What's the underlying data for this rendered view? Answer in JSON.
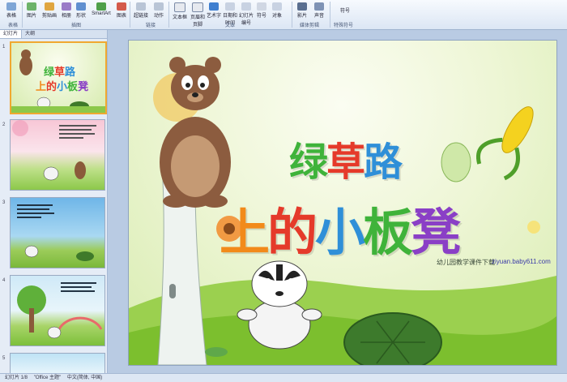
{
  "ribbon": {
    "buttons": [
      "表格",
      "图片",
      "剪贴画",
      "相册",
      "形状",
      "SmartArt",
      "图表",
      "超链接",
      "动作",
      "文本框",
      "页眉和页脚",
      "艺术字",
      "日期和时间",
      "幻灯片编号",
      "符号",
      "对象",
      "影片",
      "声音"
    ],
    "groups": [
      "表格",
      "插图",
      "链接",
      "文本",
      "媒体剪辑",
      "特殊符号"
    ],
    "symbol_label": "符号"
  },
  "panel": {
    "tabs": [
      "幻灯片",
      "大纲"
    ],
    "slide_numbers": [
      "1",
      "2",
      "3",
      "4",
      "5"
    ]
  },
  "slide": {
    "title_chars": [
      "绿",
      "草",
      "路",
      "上",
      "的",
      "小",
      "板",
      "凳"
    ],
    "watermark": "幼儿园教学课件下载",
    "url": "ziyuan.baby611.com"
  },
  "status": {
    "slide_info": "幻灯片 1/8",
    "theme": "\"Office 主题\"",
    "language": "中文(简体, 中国)"
  },
  "colors": {
    "green": "#3fb33a",
    "red": "#e53a2a",
    "blue": "#2f8fd8",
    "orange": "#f28a1a",
    "purple": "#8a3fc6"
  }
}
